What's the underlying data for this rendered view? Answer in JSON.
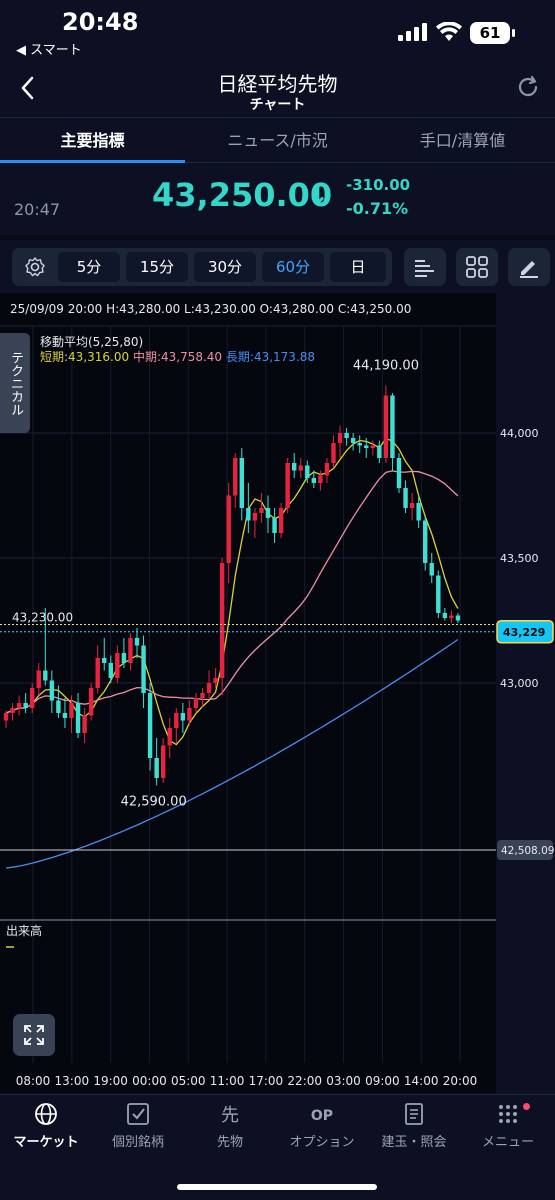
{
  "status": {
    "time": "20:48",
    "back_app": "◀ スマート",
    "battery": "61"
  },
  "header": {
    "title": "日経平均先物",
    "subtitle": "チャート"
  },
  "tabs": [
    {
      "label": "主要指標",
      "active": true
    },
    {
      "label": "ニュース/市況",
      "active": false
    },
    {
      "label": "手口/清算値",
      "active": false
    }
  ],
  "price": {
    "time": "20:47",
    "value": "43,250.00",
    "arrow": "↓",
    "change": "-310.00",
    "change_pct": "-0.71%",
    "color": "#33d6c8"
  },
  "toolbar": {
    "periods": [
      {
        "label": "5分",
        "active": false
      },
      {
        "label": "15分",
        "active": false
      },
      {
        "label": "30分",
        "active": false
      },
      {
        "label": "60分",
        "active": true
      },
      {
        "label": "日",
        "active": false
      }
    ]
  },
  "chart_info": {
    "ohlc": "25/09/09 20:00  H:43,280.00  L:43,230.00  O:43,280.00  C:43,250.00",
    "ma_title": "移動平均(5,25,80)",
    "ma_short": "短期:43,316.00",
    "ma_mid": "中期:43,758.40",
    "ma_long": "長期:43,173.88",
    "technical_tab": "テクニカル",
    "volume_label": "出来高"
  },
  "chart_data": {
    "type": "candlestick",
    "y_ticks": [
      {
        "value": 44000,
        "label": "44,000"
      },
      {
        "value": 43500,
        "label": "43,500"
      },
      {
        "value": 43000,
        "label": "43,000"
      }
    ],
    "x_ticks": [
      "08:00",
      "13:00",
      "19:00",
      "00:00",
      "05:00",
      "11:00",
      "17:00",
      "22:00",
      "03:00",
      "09:00",
      "14:00",
      "20:00"
    ],
    "annotations": {
      "high": {
        "value": 44190,
        "label": "44,190.00"
      },
      "low": {
        "value": 42590,
        "label": "42,590.00"
      },
      "left_price": {
        "value": 43230,
        "label": "43,230.00"
      },
      "current": {
        "value": 43229,
        "label": "43,229"
      },
      "line_level": {
        "value": 42508.09,
        "label": "42,508.09"
      }
    },
    "colors": {
      "up": "#e8233f",
      "down": "#3ee0d4",
      "ma_short": "#d9d23a",
      "ma_mid": "#f08fa0",
      "ma_long": "#4a8cf0"
    },
    "candles": [
      [
        42850,
        42890,
        42820,
        42880
      ],
      [
        42880,
        42920,
        42850,
        42900
      ],
      [
        42900,
        42950,
        42870,
        42920
      ],
      [
        42920,
        42960,
        42880,
        42900
      ],
      [
        42900,
        43000,
        42880,
        42980
      ],
      [
        42980,
        43080,
        42950,
        43050
      ],
      [
        43050,
        43300,
        42990,
        43010
      ],
      [
        43010,
        43050,
        42880,
        42930
      ],
      [
        42930,
        42990,
        42860,
        42880
      ],
      [
        42880,
        42940,
        42820,
        42860
      ],
      [
        42860,
        42950,
        42800,
        42920
      ],
      [
        42920,
        42960,
        42780,
        42800
      ],
      [
        42800,
        42900,
        42760,
        42870
      ],
      [
        42870,
        43000,
        42850,
        42980
      ],
      [
        42980,
        43150,
        42960,
        43100
      ],
      [
        43100,
        43180,
        43050,
        43080
      ],
      [
        43080,
        43110,
        43000,
        43020
      ],
      [
        43020,
        43150,
        43000,
        43120
      ],
      [
        43120,
        43180,
        43060,
        43080
      ],
      [
        43080,
        43200,
        43050,
        43180
      ],
      [
        43180,
        43220,
        43100,
        43150
      ],
      [
        43150,
        43190,
        42900,
        42960
      ],
      [
        42960,
        43000,
        42650,
        42700
      ],
      [
        42700,
        42780,
        42590,
        42620
      ],
      [
        42620,
        42780,
        42600,
        42750
      ],
      [
        42750,
        42860,
        42700,
        42820
      ],
      [
        42820,
        42900,
        42760,
        42880
      ],
      [
        42880,
        42920,
        42800,
        42850
      ],
      [
        42850,
        42930,
        42830,
        42900
      ],
      [
        42900,
        42960,
        42880,
        42940
      ],
      [
        42940,
        42980,
        42900,
        42960
      ],
      [
        42960,
        43050,
        42940,
        43000
      ],
      [
        43000,
        43060,
        42980,
        43020
      ],
      [
        43020,
        43500,
        42950,
        43480
      ],
      [
        43480,
        43800,
        43400,
        43750
      ],
      [
        43750,
        43920,
        43700,
        43900
      ],
      [
        43900,
        43940,
        43650,
        43700
      ],
      [
        43700,
        43800,
        43600,
        43650
      ],
      [
        43650,
        43700,
        43580,
        43680
      ],
      [
        43680,
        43760,
        43640,
        43700
      ],
      [
        43700,
        43750,
        43600,
        43660
      ],
      [
        43660,
        43700,
        43560,
        43600
      ],
      [
        43600,
        43720,
        43580,
        43700
      ],
      [
        43700,
        43900,
        43680,
        43880
      ],
      [
        43880,
        43920,
        43820,
        43850
      ],
      [
        43850,
        43900,
        43820,
        43870
      ],
      [
        43870,
        43890,
        43800,
        43820
      ],
      [
        43820,
        43850,
        43780,
        43800
      ],
      [
        43800,
        43850,
        43770,
        43830
      ],
      [
        43830,
        43900,
        43800,
        43880
      ],
      [
        43880,
        43990,
        43860,
        43960
      ],
      [
        43960,
        44030,
        43900,
        44000
      ],
      [
        44000,
        44020,
        43950,
        43980
      ],
      [
        43980,
        44000,
        43930,
        43960
      ],
      [
        43960,
        43990,
        43920,
        43950
      ],
      [
        43950,
        43980,
        43900,
        43940
      ],
      [
        43940,
        43970,
        43910,
        43950
      ],
      [
        43950,
        43970,
        43880,
        43900
      ],
      [
        43900,
        44190,
        43880,
        44150
      ],
      [
        44150,
        44160,
        43850,
        43900
      ],
      [
        43900,
        43920,
        43760,
        43780
      ],
      [
        43780,
        43810,
        43680,
        43700
      ],
      [
        43700,
        43760,
        43650,
        43720
      ],
      [
        43720,
        43750,
        43620,
        43650
      ],
      [
        43650,
        43670,
        43450,
        43480
      ],
      [
        43480,
        43520,
        43400,
        43430
      ],
      [
        43430,
        43450,
        43260,
        43280
      ],
      [
        43280,
        43300,
        43250,
        43260
      ],
      [
        43260,
        43290,
        43240,
        43270
      ],
      [
        43270,
        43280,
        43240,
        43250
      ]
    ]
  },
  "bottom_nav": [
    {
      "label": "マーケット",
      "icon": "globe-icon",
      "active": true
    },
    {
      "label": "個別銘柄",
      "icon": "check-square-icon",
      "active": false
    },
    {
      "label": "先物",
      "icon": "futures-icon",
      "active": false
    },
    {
      "label": "オプション",
      "icon": "option-icon",
      "active": false
    },
    {
      "label": "建玉・照会",
      "icon": "document-icon",
      "active": false
    },
    {
      "label": "メニュー",
      "icon": "menu-grid-icon",
      "active": false
    }
  ]
}
